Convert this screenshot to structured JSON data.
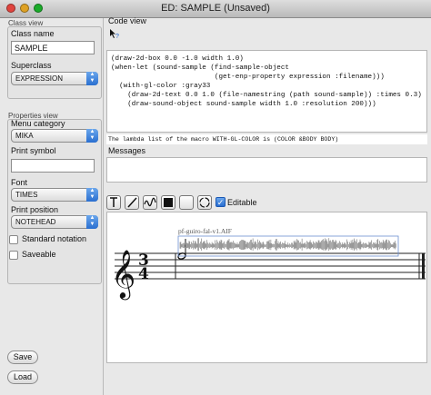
{
  "window": {
    "title": "ED: SAMPLE (Unsaved)"
  },
  "class_view": {
    "header": "Class view",
    "class_name_label": "Class name",
    "class_name_value": "SAMPLE",
    "superclass_label": "Superclass",
    "superclass_value": "EXPRESSION"
  },
  "properties_view": {
    "header": "Properties view",
    "menu_category_label": "Menu category",
    "menu_category_value": "MIKA",
    "print_symbol_label": "Print symbol",
    "print_symbol_value": "",
    "font_label": "Font",
    "font_value": "TIMES",
    "print_position_label": "Print position",
    "print_position_value": "NOTEHEAD",
    "standard_notation_label": "Standard notation",
    "saveable_label": "Saveable"
  },
  "buttons": {
    "save": "Save",
    "load": "Load"
  },
  "code_view": {
    "header": "Code view",
    "lines": [
      "(draw-2d-box 0.0 -1.0 width 1.0)",
      "(when-let (sound-sample (find-sample-object",
      "                         (get-enp-property expression :filename)))",
      "  (with-gl-color :gray33",
      "    (draw-2d-text 0.0 1.0 (file-namestring (path sound-sample)) :times 0.3)",
      "    (draw-sound-object sound-sample width 1.0 :resolution 200)))"
    ],
    "status": "The lambda list of the macro WITH-GL-COLOR is (COLOR &BODY BODY)"
  },
  "messages": {
    "header": "Messages"
  },
  "toolbar": {
    "editable_label": "Editable",
    "editable_checked": true
  },
  "score": {
    "sample_filename": "pf-guiro-fal-v1.AIF",
    "time_signature_top": "3",
    "time_signature_bottom": "4"
  },
  "colors": {
    "accent": "#2a6fd0",
    "close": "#e0443e",
    "minimize": "#dea123",
    "zoom": "#1aab29"
  }
}
